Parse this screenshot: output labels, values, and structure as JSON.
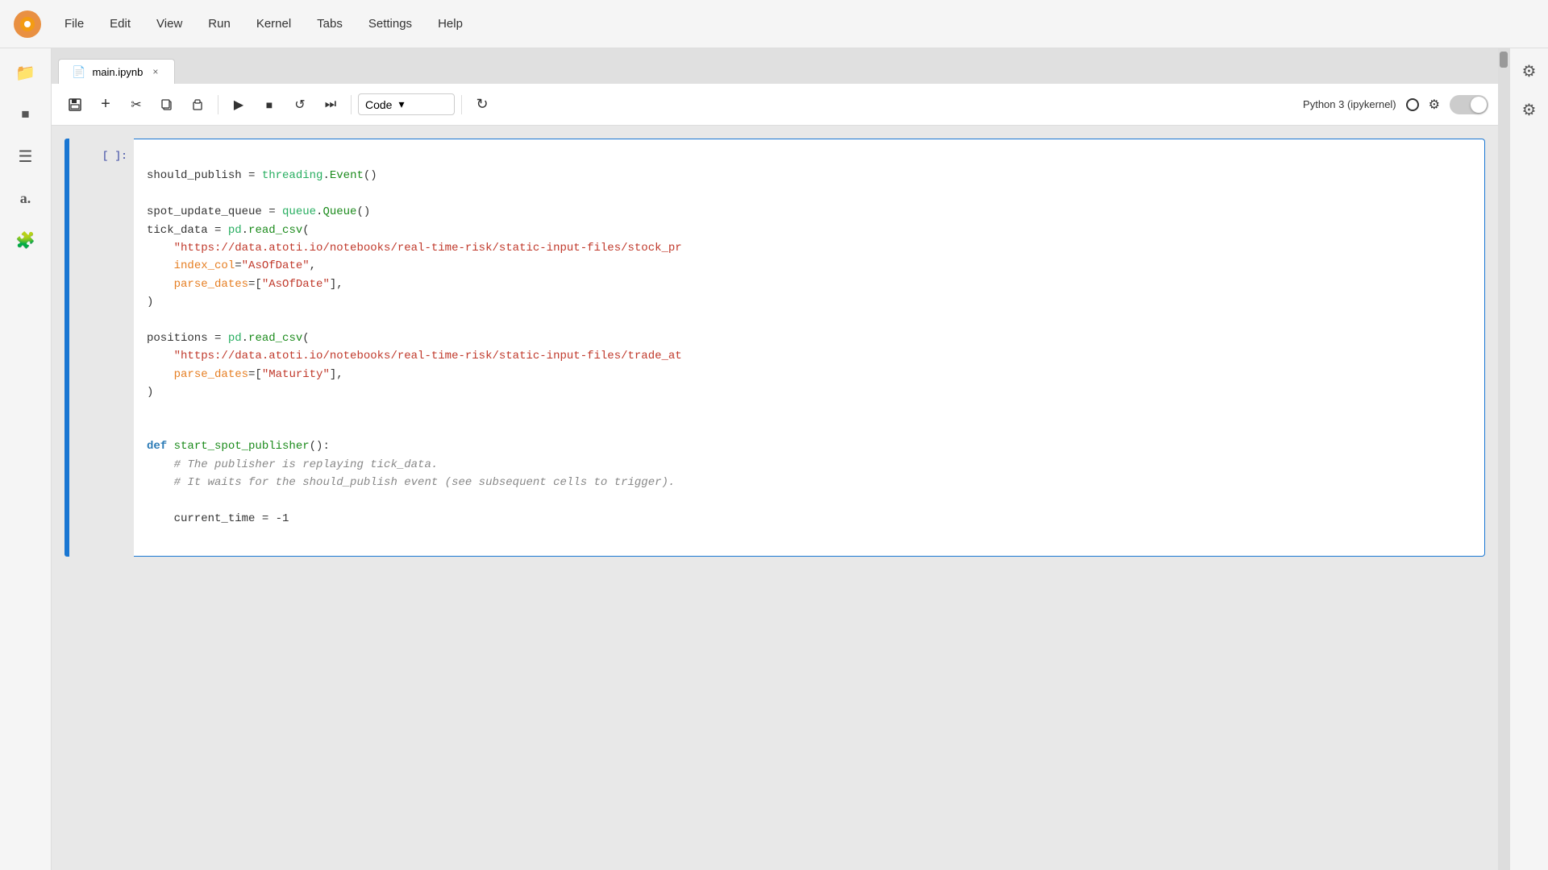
{
  "app": {
    "logo_unicode": "🟠",
    "menu_items": [
      "File",
      "Edit",
      "View",
      "Run",
      "Kernel",
      "Tabs",
      "Settings",
      "Help"
    ]
  },
  "sidebar": {
    "icons": [
      {
        "name": "folder-icon",
        "glyph": "📁"
      },
      {
        "name": "stop-icon",
        "glyph": "⏹"
      },
      {
        "name": "list-icon",
        "glyph": "☰"
      },
      {
        "name": "text-icon",
        "glyph": "a."
      },
      {
        "name": "puzzle-icon",
        "glyph": "🧩"
      }
    ]
  },
  "right_sidebar": {
    "icons": [
      {
        "name": "gear-icon",
        "glyph": "⚙"
      },
      {
        "name": "settings2-icon",
        "glyph": "⚙"
      }
    ]
  },
  "tab": {
    "label": "main.ipynb",
    "close": "×"
  },
  "toolbar": {
    "save_label": "💾",
    "add_label": "+",
    "cut_label": "✂",
    "copy_label": "⎘",
    "paste_label": "📋",
    "run_label": "▶",
    "stop_label": "■",
    "restart_label": "↺",
    "fast_forward_label": "⏩",
    "cell_type": "Code",
    "cell_type_arrow": "▾",
    "refresh_label": "↻",
    "kernel_name": "Python 3 (ipykernel)"
  },
  "cell": {
    "prompt": "[ ]:",
    "code_lines": [
      "should_publish = threading.Event()",
      "",
      "spot_update_queue = queue.Queue()",
      "tick_data = pd.read_csv(",
      "    \"https://data.atoti.io/notebooks/real-time-risk/static-input-files/stock_pr",
      "    index_col=\"AsOfDate\",",
      "    parse_dates=[\"AsOfDate\"],",
      ")",
      "",
      "positions = pd.read_csv(",
      "    \"https://data.atoti.io/notebooks/real-time-risk/static-input-files/trade_at",
      "    parse_dates=[\"Maturity\"],",
      ")",
      "",
      "",
      "def start_spot_publisher():",
      "    # The publisher is replaying tick_data.",
      "    # It waits for the should_publish event (see subsequent cells to trigger).",
      "",
      "    current_time = -1"
    ]
  }
}
